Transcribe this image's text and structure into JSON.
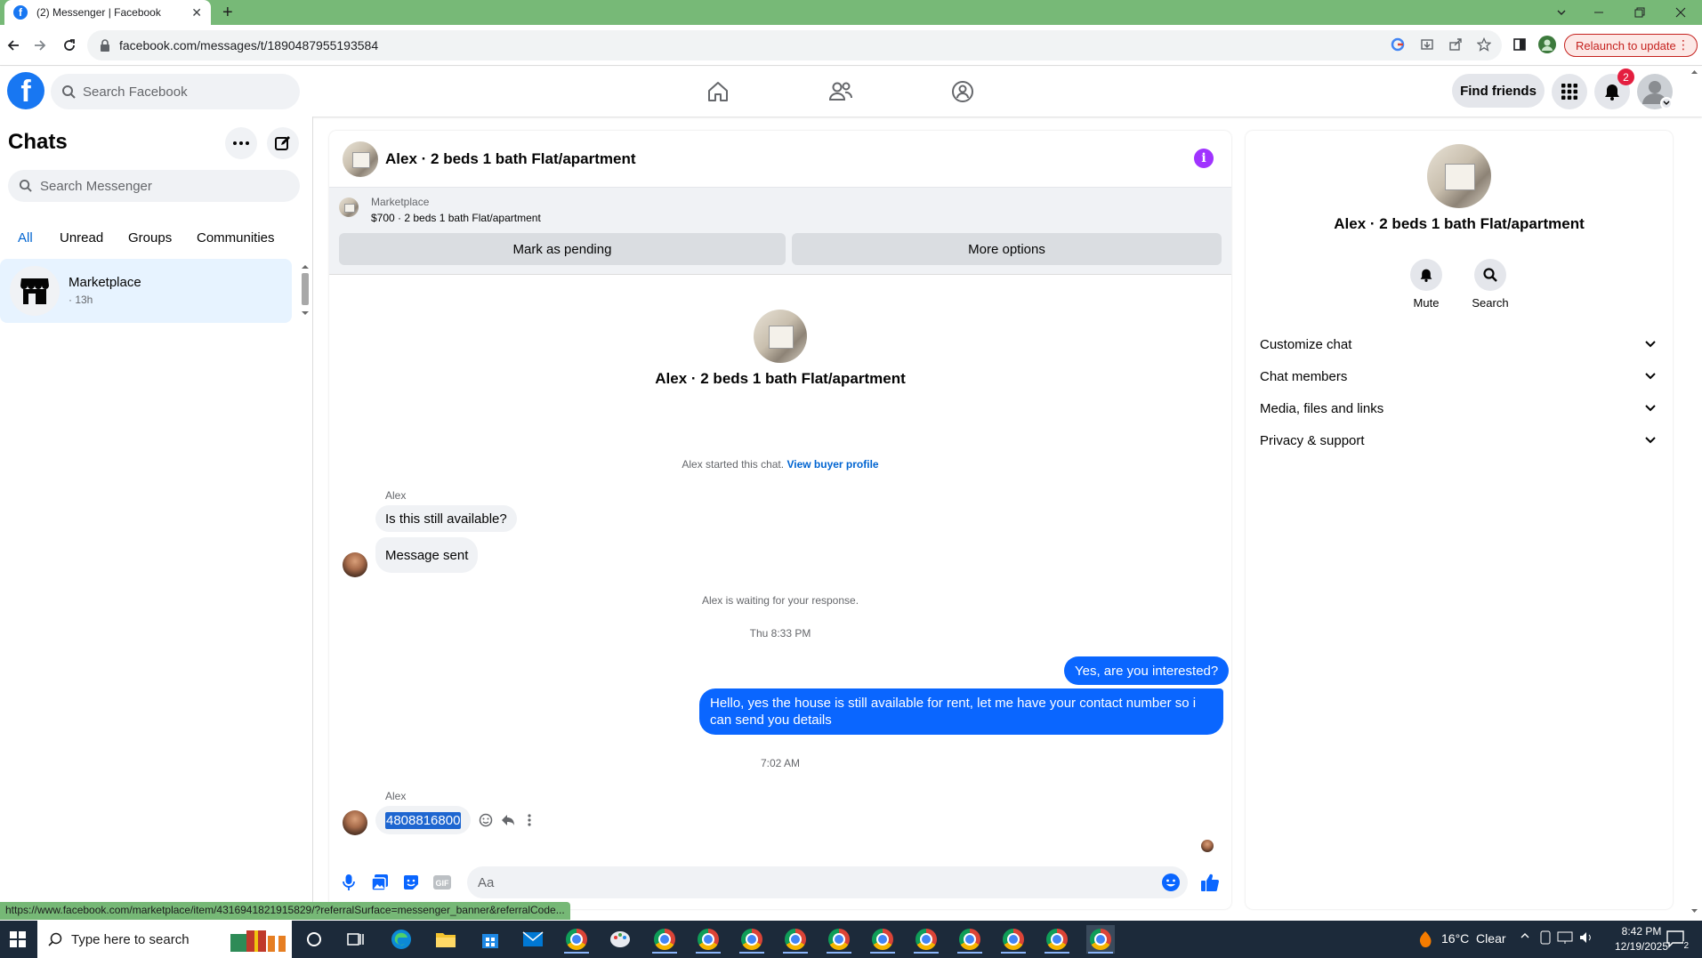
{
  "browser": {
    "tab_title": "(2) Messenger | Facebook",
    "url": "facebook.com/messages/t/1890487955193584",
    "relaunch_label": "Relaunch to update",
    "new_tab_symbol": "+",
    "close_tab_symbol": "✕",
    "status_url": "https://www.facebook.com/marketplace/item/4316941821915829/?referralSurface=messenger_banner&referralCode..."
  },
  "fb_nav": {
    "search_placeholder": "Search Facebook",
    "find_friends_label": "Find friends",
    "notification_count": "2",
    "icons": [
      "home-icon",
      "friends-icon",
      "groups-icon",
      "menu-grid-icon",
      "bell-icon",
      "profile-avatar"
    ]
  },
  "chats_panel": {
    "title": "Chats",
    "search_placeholder": "Search Messenger",
    "filters": [
      {
        "label": "All",
        "active": true
      },
      {
        "label": "Unread",
        "active": false
      },
      {
        "label": "Groups",
        "active": false
      },
      {
        "label": "Communities",
        "active": false
      }
    ],
    "rows": [
      {
        "name": "Marketplace",
        "time": "· 13h"
      }
    ]
  },
  "conversation": {
    "title": "Alex · 2 beds 1 bath Flat/apartment",
    "marketplace_banner": {
      "label": "Marketplace",
      "listing": "$700 · 2 beds 1 bath Flat/apartment",
      "mark_pending_label": "Mark as pending",
      "more_options_label": "More options"
    },
    "intro_name": "Alex · 2 beds 1 bath Flat/apartment",
    "started_text": "Alex started this chat.",
    "view_buyer_profile": "View buyer profile",
    "messages": [
      {
        "sender": "Alex",
        "text": "Is this still available?",
        "direction": "in"
      },
      {
        "sender": "Alex",
        "text": "Message sent",
        "direction": "in"
      },
      {
        "text": "Alex is waiting for your response.",
        "kind": "system"
      },
      {
        "text": "Thu 8:33 PM",
        "kind": "timestamp"
      },
      {
        "text": "Yes, are you interested?",
        "direction": "out"
      },
      {
        "text": "Hello, yes the house is still available for rent, let me have your contact number so i can send you details",
        "direction": "out"
      },
      {
        "text": "7:02 AM",
        "kind": "timestamp"
      },
      {
        "sender": "Alex",
        "text": "4808816800",
        "direction": "in",
        "selected": true
      }
    ],
    "composer_placeholder": "Aa"
  },
  "info_panel": {
    "name": "Alex · 2 beds 1 bath Flat/apartment",
    "actions": [
      {
        "label": "Mute",
        "icon": "bell-icon"
      },
      {
        "label": "Search",
        "icon": "search-icon"
      }
    ],
    "sections": [
      {
        "label": "Customize chat"
      },
      {
        "label": "Chat members"
      },
      {
        "label": "Media, files and links"
      },
      {
        "label": "Privacy & support"
      }
    ]
  },
  "taskbar": {
    "search_placeholder": "Type here to search",
    "weather": "16°C  Clear",
    "time": "8:42 PM",
    "date": "12/19/2025",
    "notification_count": "2"
  },
  "colors": {
    "fb_blue": "#1877f2",
    "messenger_blue": "#0a66ff",
    "chrome_frame": "#77b977",
    "info_purple": "#a033ff",
    "badge_red": "#e41e3f"
  }
}
